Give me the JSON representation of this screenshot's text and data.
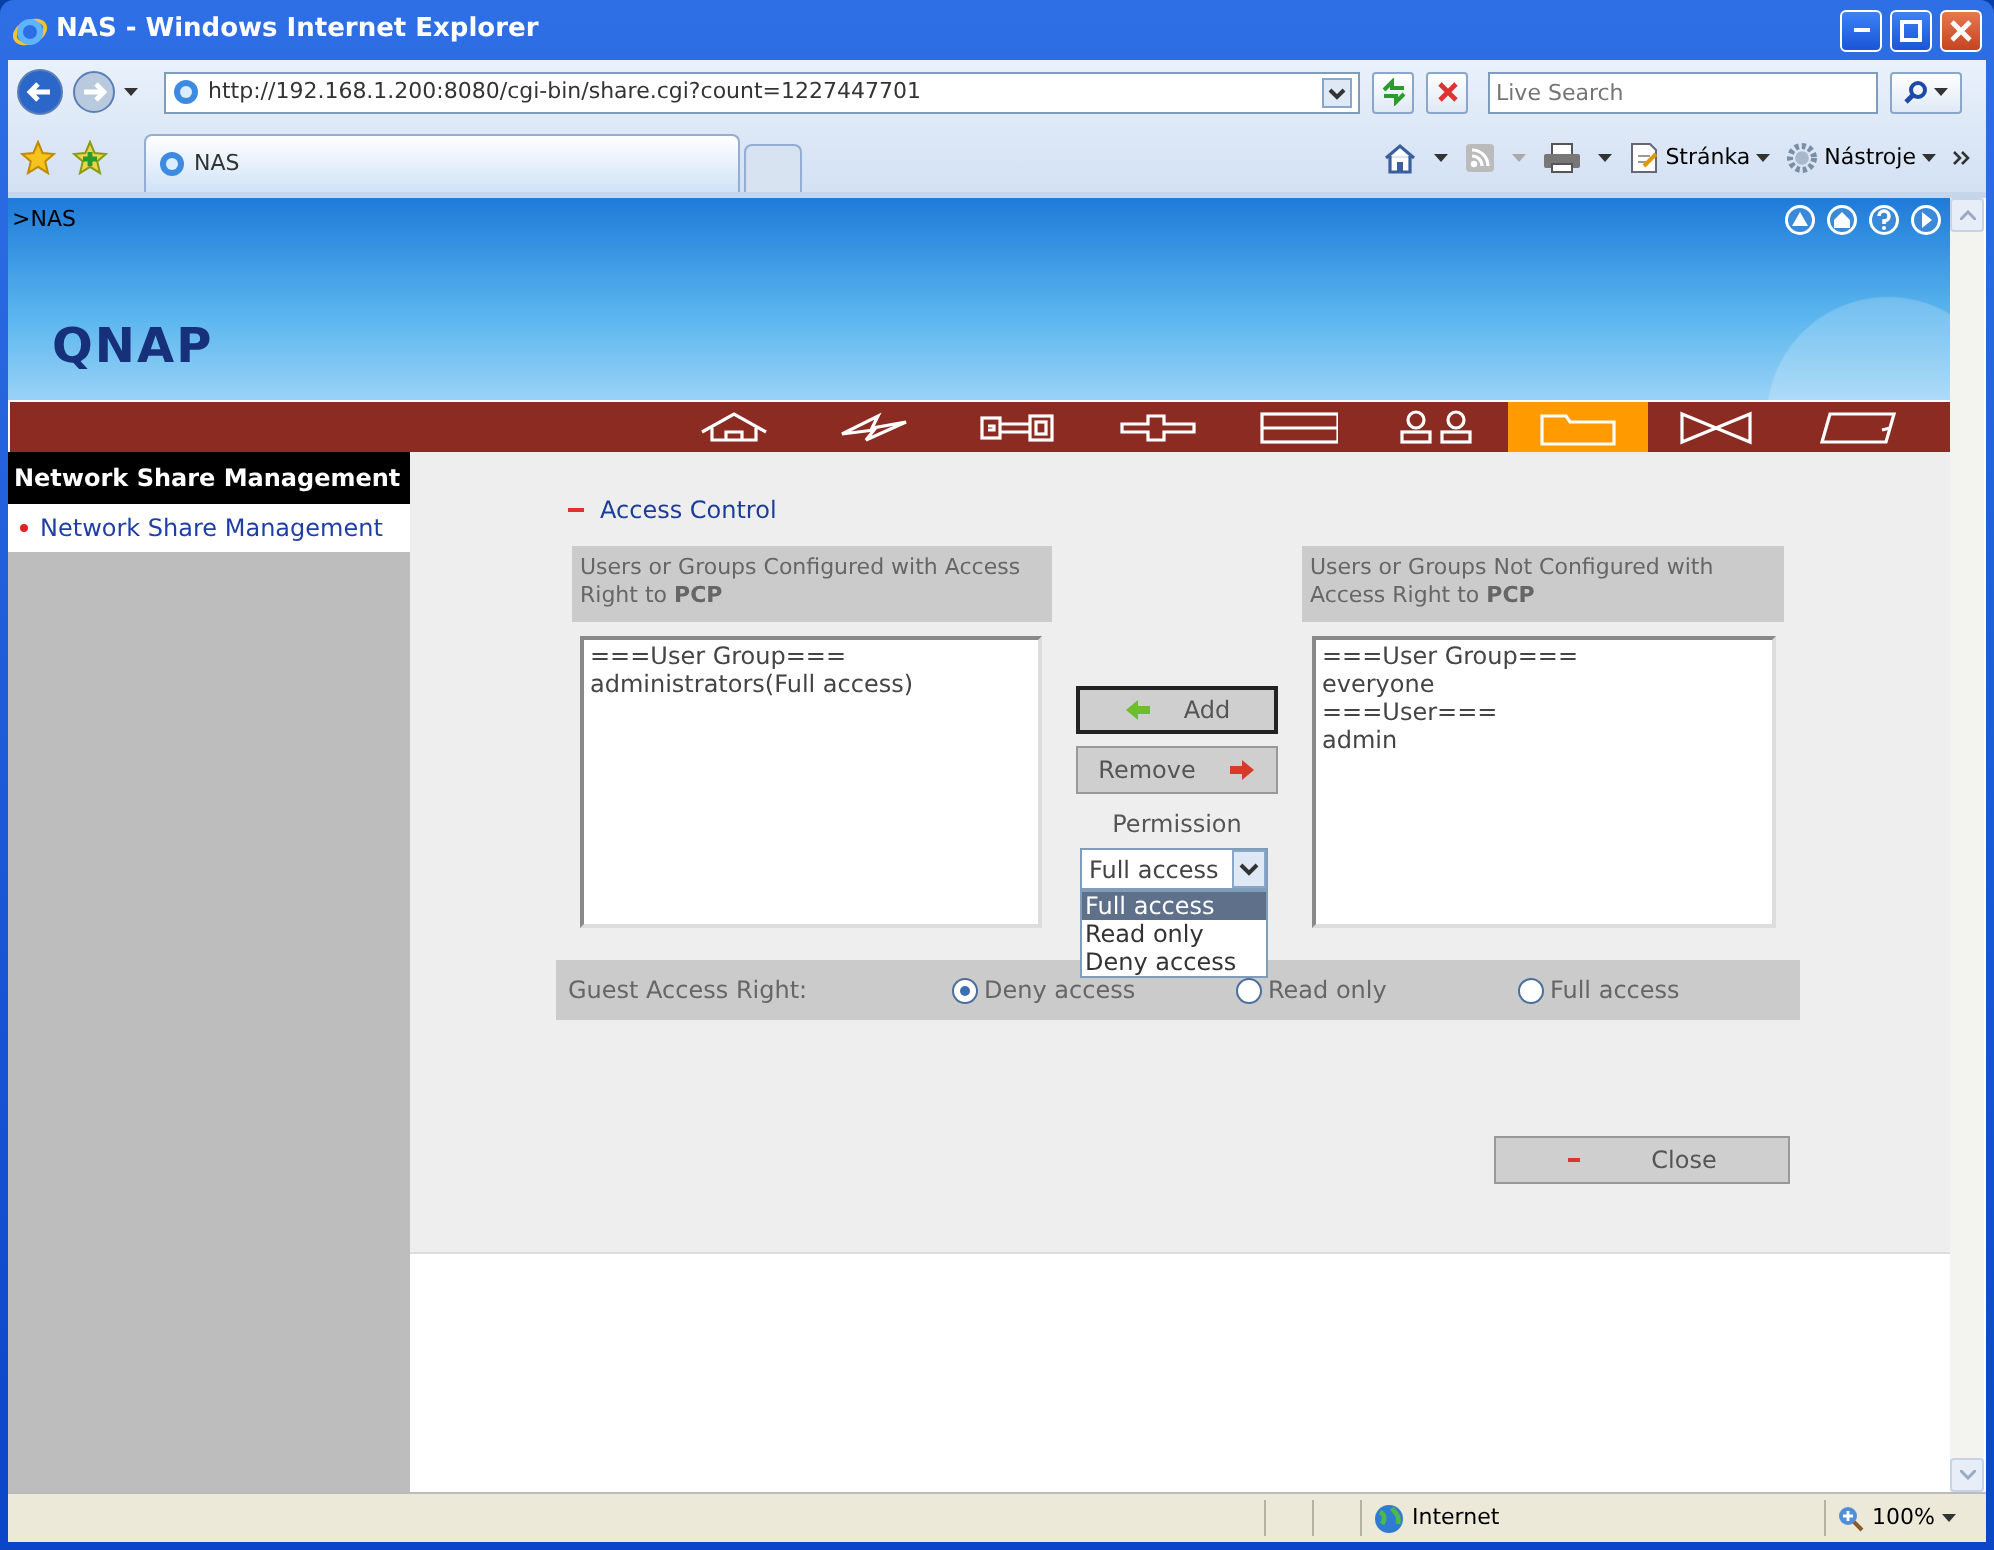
{
  "window": {
    "title": "NAS - Windows Internet Explorer"
  },
  "address_bar": {
    "url": "http://192.168.1.200:8080/cgi-bin/share.cgi?count=1227447701",
    "search_placeholder": "Live Search"
  },
  "tabs": [
    {
      "label": "NAS",
      "selected": true
    }
  ],
  "toolbar": [
    {
      "label": "Stránka"
    },
    {
      "label": "Nástroje"
    }
  ],
  "header": {
    "breadcrumb": ">NAS",
    "logo": "QNAP"
  },
  "nav": [
    {
      "kind": "home",
      "selected": false
    },
    {
      "kind": "wizard",
      "selected": false
    },
    {
      "kind": "system",
      "selected": false
    },
    {
      "kind": "network",
      "selected": false
    },
    {
      "kind": "disk",
      "selected": false
    },
    {
      "kind": "users",
      "selected": false
    },
    {
      "kind": "share",
      "selected": true
    },
    {
      "kind": "application",
      "selected": false
    },
    {
      "kind": "backup",
      "selected": false
    }
  ],
  "sidebar": {
    "title": "Network Share Management",
    "items": [
      {
        "label": "Network Share Management"
      }
    ]
  },
  "section": {
    "title": "Access Control",
    "expanded": true
  },
  "configured": {
    "heading": "Users or Groups Configured with Access Right to **PCP**",
    "items": [
      "===User Group===",
      "administrators(Full access)"
    ]
  },
  "not_configured": {
    "heading": "Users or Groups Not Configured with Access Right to **PCP**",
    "items": [
      "===User Group===",
      "everyone",
      "===User===",
      "admin"
    ]
  },
  "buttons": [
    {
      "kind": "add",
      "label": "Add",
      "focused": true
    },
    {
      "kind": "remove",
      "label": "Remove",
      "focused": false
    }
  ],
  "permission": {
    "label": "Permission",
    "value": "Full access",
    "expanded": true,
    "options": [
      {
        "label": "Full access",
        "selected": true
      },
      {
        "label": "Read only",
        "selected": false
      },
      {
        "label": "Deny access",
        "selected": false
      }
    ]
  },
  "guest_access": {
    "label": "Guest Access Right:",
    "options": [
      {
        "label": "Deny access",
        "selected": true
      },
      {
        "label": "Read only",
        "selected": false
      },
      {
        "label": "Full access",
        "selected": false
      }
    ]
  },
  "close_button": {
    "label": "Close"
  },
  "status_bar": {
    "zone": "Internet",
    "zoom": "100%"
  }
}
